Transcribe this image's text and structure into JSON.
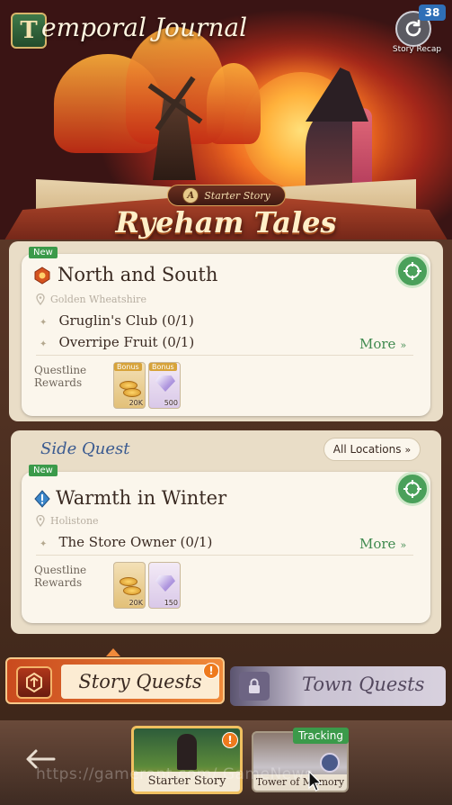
{
  "header": {
    "journal_icon_letter": "T",
    "title": "emporal Journal",
    "recap_count": "38",
    "recap_label": "Story Recap"
  },
  "starter": {
    "ribbon_seal": "A",
    "ribbon_label": "Starter Story",
    "story_title": "Ryeham Tales"
  },
  "main_quest": {
    "new_tag": "New",
    "title": "North and South",
    "location": "Golden Wheatshire",
    "objectives": [
      "Gruglin's Club (0/1)",
      "Overripe Fruit (0/1)"
    ],
    "more_label": "More",
    "rewards_label_1": "Questline",
    "rewards_label_2": "Rewards",
    "rewards": [
      {
        "kind": "gold",
        "bonus": "Bonus",
        "amount": "20K"
      },
      {
        "kind": "gem",
        "bonus": "Bonus",
        "amount": "500"
      }
    ]
  },
  "side_quest": {
    "section_title": "Side Quest",
    "filter_label": "All Locations",
    "new_tag": "New",
    "title": "Warmth in Winter",
    "location": "Holistone",
    "objectives": [
      "The Store Owner (0/1)"
    ],
    "more_label": "More",
    "rewards_label_1": "Questline",
    "rewards_label_2": "Rewards",
    "rewards": [
      {
        "kind": "gold",
        "amount": "20K"
      },
      {
        "kind": "gem",
        "amount": "150"
      }
    ]
  },
  "tabs": {
    "story_label": "Story Quests",
    "story_alert": "!",
    "town_label": "Town Quests"
  },
  "bottom": {
    "starter_story_label": "Starter Story",
    "starter_alert": "!",
    "tracking_label": "Tracking",
    "tower_label": "Tower of Memory",
    "watermark": "https://gamerant.com/ GameNews"
  },
  "colors": {
    "accent_green": "#3b9a4a",
    "side_title_blue": "#3a5a90",
    "story_tab_orange": "#e0662a"
  }
}
